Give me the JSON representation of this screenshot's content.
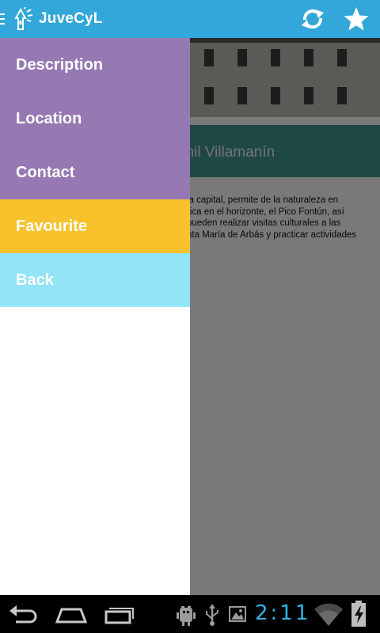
{
  "app": {
    "title": "JuveCyL",
    "accent_color": "#33a7d9",
    "logo_icon": "juvecyl-logo-icon",
    "actions": [
      {
        "icon": "refresh-icon"
      },
      {
        "icon": "star-icon"
      }
    ]
  },
  "background": {
    "place_name_visible": "enil Villamanín",
    "description_visible_lines": [
      "la capital, permite de la naturaleza en",
      "rica en el horizonte, el Pico Fontún, así",
      "pueden realizar visitas culturales a las",
      "nta María de Arbás y practicar actividades"
    ],
    "band_color": "#3d8f8c"
  },
  "drawer": {
    "items": [
      {
        "label": "Description",
        "color": "#9679b3"
      },
      {
        "label": "Location",
        "color": "#9679b3"
      },
      {
        "label": "Contact",
        "color": "#9679b3"
      },
      {
        "label": "Favourite",
        "color": "#f7c22c"
      },
      {
        "label": "Back",
        "color": "#93e4f7"
      }
    ]
  },
  "system_bar": {
    "time": "2:11",
    "nav_icons": [
      "back-icon",
      "home-icon",
      "recents-icon"
    ],
    "status_icons": [
      "android-debug-icon",
      "usb-icon",
      "gallery-icon",
      "wifi-icon",
      "battery-charging-icon"
    ]
  }
}
